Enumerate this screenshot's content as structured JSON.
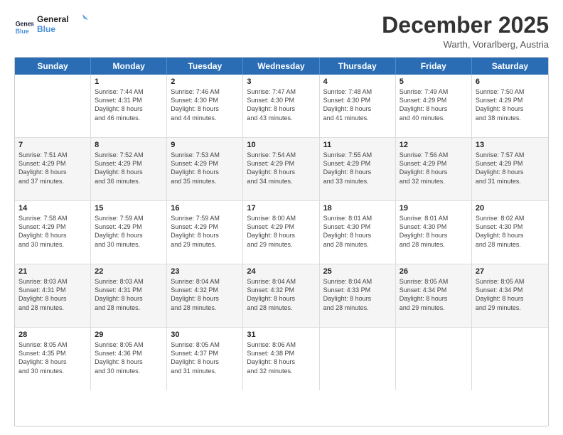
{
  "logo": {
    "line1": "General",
    "line2": "Blue"
  },
  "title": "December 2025",
  "subtitle": "Warth, Vorarlberg, Austria",
  "days": [
    "Sunday",
    "Monday",
    "Tuesday",
    "Wednesday",
    "Thursday",
    "Friday",
    "Saturday"
  ],
  "weeks": [
    [
      {
        "day": "",
        "lines": []
      },
      {
        "day": "1",
        "lines": [
          "Sunrise: 7:44 AM",
          "Sunset: 4:31 PM",
          "Daylight: 8 hours",
          "and 46 minutes."
        ]
      },
      {
        "day": "2",
        "lines": [
          "Sunrise: 7:46 AM",
          "Sunset: 4:30 PM",
          "Daylight: 8 hours",
          "and 44 minutes."
        ]
      },
      {
        "day": "3",
        "lines": [
          "Sunrise: 7:47 AM",
          "Sunset: 4:30 PM",
          "Daylight: 8 hours",
          "and 43 minutes."
        ]
      },
      {
        "day": "4",
        "lines": [
          "Sunrise: 7:48 AM",
          "Sunset: 4:30 PM",
          "Daylight: 8 hours",
          "and 41 minutes."
        ]
      },
      {
        "day": "5",
        "lines": [
          "Sunrise: 7:49 AM",
          "Sunset: 4:29 PM",
          "Daylight: 8 hours",
          "and 40 minutes."
        ]
      },
      {
        "day": "6",
        "lines": [
          "Sunrise: 7:50 AM",
          "Sunset: 4:29 PM",
          "Daylight: 8 hours",
          "and 38 minutes."
        ]
      }
    ],
    [
      {
        "day": "7",
        "lines": [
          "Sunrise: 7:51 AM",
          "Sunset: 4:29 PM",
          "Daylight: 8 hours",
          "and 37 minutes."
        ]
      },
      {
        "day": "8",
        "lines": [
          "Sunrise: 7:52 AM",
          "Sunset: 4:29 PM",
          "Daylight: 8 hours",
          "and 36 minutes."
        ]
      },
      {
        "day": "9",
        "lines": [
          "Sunrise: 7:53 AM",
          "Sunset: 4:29 PM",
          "Daylight: 8 hours",
          "and 35 minutes."
        ]
      },
      {
        "day": "10",
        "lines": [
          "Sunrise: 7:54 AM",
          "Sunset: 4:29 PM",
          "Daylight: 8 hours",
          "and 34 minutes."
        ]
      },
      {
        "day": "11",
        "lines": [
          "Sunrise: 7:55 AM",
          "Sunset: 4:29 PM",
          "Daylight: 8 hours",
          "and 33 minutes."
        ]
      },
      {
        "day": "12",
        "lines": [
          "Sunrise: 7:56 AM",
          "Sunset: 4:29 PM",
          "Daylight: 8 hours",
          "and 32 minutes."
        ]
      },
      {
        "day": "13",
        "lines": [
          "Sunrise: 7:57 AM",
          "Sunset: 4:29 PM",
          "Daylight: 8 hours",
          "and 31 minutes."
        ]
      }
    ],
    [
      {
        "day": "14",
        "lines": [
          "Sunrise: 7:58 AM",
          "Sunset: 4:29 PM",
          "Daylight: 8 hours",
          "and 30 minutes."
        ]
      },
      {
        "day": "15",
        "lines": [
          "Sunrise: 7:59 AM",
          "Sunset: 4:29 PM",
          "Daylight: 8 hours",
          "and 30 minutes."
        ]
      },
      {
        "day": "16",
        "lines": [
          "Sunrise: 7:59 AM",
          "Sunset: 4:29 PM",
          "Daylight: 8 hours",
          "and 29 minutes."
        ]
      },
      {
        "day": "17",
        "lines": [
          "Sunrise: 8:00 AM",
          "Sunset: 4:29 PM",
          "Daylight: 8 hours",
          "and 29 minutes."
        ]
      },
      {
        "day": "18",
        "lines": [
          "Sunrise: 8:01 AM",
          "Sunset: 4:30 PM",
          "Daylight: 8 hours",
          "and 28 minutes."
        ]
      },
      {
        "day": "19",
        "lines": [
          "Sunrise: 8:01 AM",
          "Sunset: 4:30 PM",
          "Daylight: 8 hours",
          "and 28 minutes."
        ]
      },
      {
        "day": "20",
        "lines": [
          "Sunrise: 8:02 AM",
          "Sunset: 4:30 PM",
          "Daylight: 8 hours",
          "and 28 minutes."
        ]
      }
    ],
    [
      {
        "day": "21",
        "lines": [
          "Sunrise: 8:03 AM",
          "Sunset: 4:31 PM",
          "Daylight: 8 hours",
          "and 28 minutes."
        ]
      },
      {
        "day": "22",
        "lines": [
          "Sunrise: 8:03 AM",
          "Sunset: 4:31 PM",
          "Daylight: 8 hours",
          "and 28 minutes."
        ]
      },
      {
        "day": "23",
        "lines": [
          "Sunrise: 8:04 AM",
          "Sunset: 4:32 PM",
          "Daylight: 8 hours",
          "and 28 minutes."
        ]
      },
      {
        "day": "24",
        "lines": [
          "Sunrise: 8:04 AM",
          "Sunset: 4:32 PM",
          "Daylight: 8 hours",
          "and 28 minutes."
        ]
      },
      {
        "day": "25",
        "lines": [
          "Sunrise: 8:04 AM",
          "Sunset: 4:33 PM",
          "Daylight: 8 hours",
          "and 28 minutes."
        ]
      },
      {
        "day": "26",
        "lines": [
          "Sunrise: 8:05 AM",
          "Sunset: 4:34 PM",
          "Daylight: 8 hours",
          "and 29 minutes."
        ]
      },
      {
        "day": "27",
        "lines": [
          "Sunrise: 8:05 AM",
          "Sunset: 4:34 PM",
          "Daylight: 8 hours",
          "and 29 minutes."
        ]
      }
    ],
    [
      {
        "day": "28",
        "lines": [
          "Sunrise: 8:05 AM",
          "Sunset: 4:35 PM",
          "Daylight: 8 hours",
          "and 30 minutes."
        ]
      },
      {
        "day": "29",
        "lines": [
          "Sunrise: 8:05 AM",
          "Sunset: 4:36 PM",
          "Daylight: 8 hours",
          "and 30 minutes."
        ]
      },
      {
        "day": "30",
        "lines": [
          "Sunrise: 8:05 AM",
          "Sunset: 4:37 PM",
          "Daylight: 8 hours",
          "and 31 minutes."
        ]
      },
      {
        "day": "31",
        "lines": [
          "Sunrise: 8:06 AM",
          "Sunset: 4:38 PM",
          "Daylight: 8 hours",
          "and 32 minutes."
        ]
      },
      {
        "day": "",
        "lines": []
      },
      {
        "day": "",
        "lines": []
      },
      {
        "day": "",
        "lines": []
      }
    ]
  ]
}
